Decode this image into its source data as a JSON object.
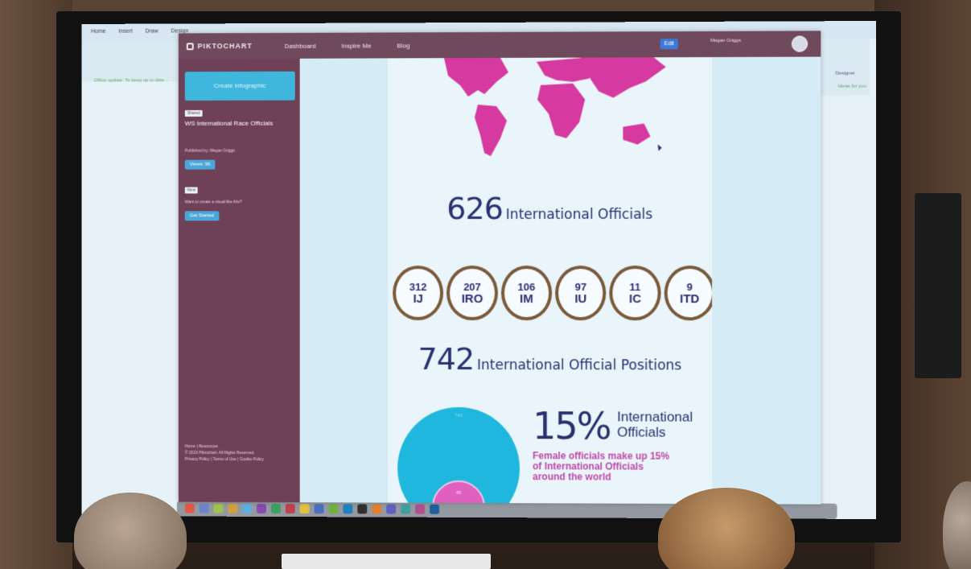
{
  "background_app": {
    "menu": [
      "Home",
      "Insert",
      "Draw",
      "Design"
    ],
    "notice": "Office update: To keep up to date...",
    "right_tool_label": "Designer",
    "right_notice": "Ideas for you"
  },
  "app": {
    "logo": "PIKTOCHART",
    "nav": [
      "Dashboard",
      "Inspire Me",
      "Blog"
    ],
    "edit_label": "Edit",
    "user_name": "Megan Griggs"
  },
  "sidebar": {
    "create_button": "Create infographic",
    "tag_label": "Shared",
    "title": "WS International Race Officials",
    "published_by": "Published by: Megan Griggs",
    "views_button": "Views: 96",
    "next_tag": "Next",
    "question": "Want to create a visual like this?",
    "start_button": "Get Started",
    "footer_links": [
      "Home",
      "Resources"
    ],
    "footer_copyright": "© 2023 Piktochart. All Rights Reserved.",
    "footer_legal": [
      "Privacy Policy",
      "Terms of Use",
      "Cookie Policy"
    ]
  },
  "infographic": {
    "stat1": {
      "number": "626",
      "label": "International Officials"
    },
    "categories": [
      {
        "count": "312",
        "code": "IJ"
      },
      {
        "count": "207",
        "code": "IRO"
      },
      {
        "count": "106",
        "code": "IM"
      },
      {
        "count": "97",
        "code": "IU"
      },
      {
        "count": "11",
        "code": "IC"
      },
      {
        "count": "9",
        "code": "ITD"
      }
    ],
    "stat2": {
      "number": "742",
      "label": "International Official Positions"
    },
    "stat3": {
      "number": "15%",
      "label_line1": "International",
      "label_line2": "Officials",
      "description": "Female officials make up 15% of International Officials around the world"
    },
    "pie": {
      "total_label": "742",
      "female_label": "45",
      "female_fraction": 0.15
    }
  },
  "colors": {
    "nav": "#6f4a5c",
    "sidebar": "#6e4157",
    "accent_blue": "#3fb6dc",
    "map_pink": "#d63aa0",
    "text_navy": "#2c2f6e",
    "pie_blue": "#1fb7dd",
    "pie_pink": "#e060c0"
  }
}
